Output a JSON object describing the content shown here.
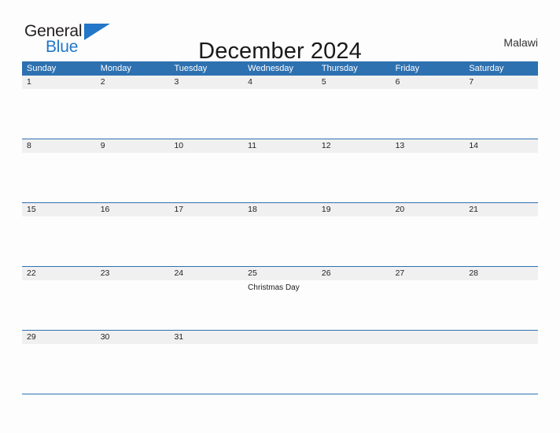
{
  "brand": {
    "name_top": "General",
    "name_bottom": "Blue",
    "flag_icon": "blue-flag-triangle",
    "color_dark": "#231f20",
    "color_blue": "#2277c8"
  },
  "header": {
    "title": "December 2024",
    "country": "Malawi"
  },
  "theme": {
    "header_blue": "#2e71b1",
    "band_gray": "#f0f0f0",
    "page_bg": "#fdfdfd",
    "text": "#222222"
  },
  "calendar": {
    "month": "December",
    "year": "2024",
    "weekday_headers": [
      "Sunday",
      "Monday",
      "Tuesday",
      "Wednesday",
      "Thursday",
      "Friday",
      "Saturday"
    ],
    "weeks": [
      [
        {
          "date": "1",
          "events": []
        },
        {
          "date": "2",
          "events": []
        },
        {
          "date": "3",
          "events": []
        },
        {
          "date": "4",
          "events": []
        },
        {
          "date": "5",
          "events": []
        },
        {
          "date": "6",
          "events": []
        },
        {
          "date": "7",
          "events": []
        }
      ],
      [
        {
          "date": "8",
          "events": []
        },
        {
          "date": "9",
          "events": []
        },
        {
          "date": "10",
          "events": []
        },
        {
          "date": "11",
          "events": []
        },
        {
          "date": "12",
          "events": []
        },
        {
          "date": "13",
          "events": []
        },
        {
          "date": "14",
          "events": []
        }
      ],
      [
        {
          "date": "15",
          "events": []
        },
        {
          "date": "16",
          "events": []
        },
        {
          "date": "17",
          "events": []
        },
        {
          "date": "18",
          "events": []
        },
        {
          "date": "19",
          "events": []
        },
        {
          "date": "20",
          "events": []
        },
        {
          "date": "21",
          "events": []
        }
      ],
      [
        {
          "date": "22",
          "events": []
        },
        {
          "date": "23",
          "events": []
        },
        {
          "date": "24",
          "events": []
        },
        {
          "date": "25",
          "events": [
            "Christmas Day"
          ]
        },
        {
          "date": "26",
          "events": []
        },
        {
          "date": "27",
          "events": []
        },
        {
          "date": "28",
          "events": []
        }
      ],
      [
        {
          "date": "29",
          "events": []
        },
        {
          "date": "30",
          "events": []
        },
        {
          "date": "31",
          "events": []
        },
        {
          "date": "",
          "events": []
        },
        {
          "date": "",
          "events": []
        },
        {
          "date": "",
          "events": []
        },
        {
          "date": "",
          "events": []
        }
      ]
    ]
  }
}
